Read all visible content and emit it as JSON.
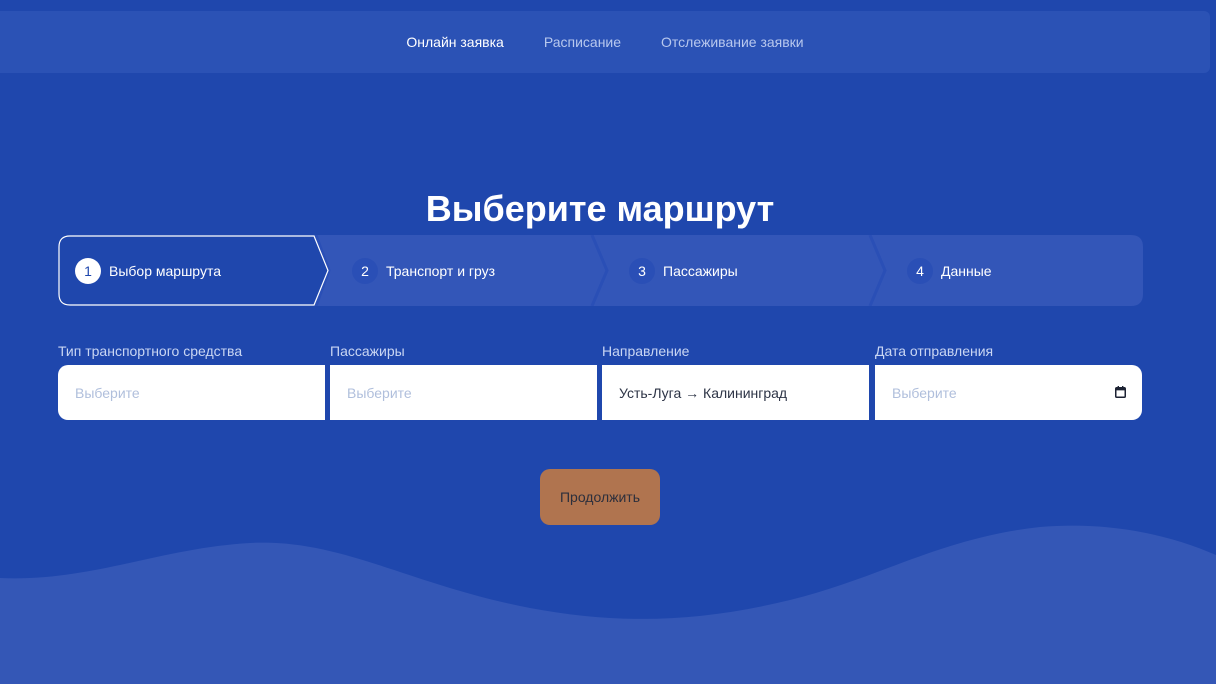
{
  "nav": {
    "items": [
      {
        "label": "Онлайн заявка",
        "active": true
      },
      {
        "label": "Расписание",
        "active": false
      },
      {
        "label": "Отслеживание заявки",
        "active": false
      }
    ]
  },
  "title": "Выберите маршрут",
  "steps": [
    {
      "number": "1",
      "label": "Выбор маршрута",
      "active": true
    },
    {
      "number": "2",
      "label": "Транспорт и груз",
      "active": false
    },
    {
      "number": "3",
      "label": "Пассажиры",
      "active": false
    },
    {
      "number": "4",
      "label": "Данные",
      "active": false
    }
  ],
  "form": {
    "vehicle_type": {
      "label": "Тип транспортного средства",
      "placeholder": "Выберите",
      "value": ""
    },
    "passengers": {
      "label": "Пассажиры",
      "placeholder": "Выберите",
      "value": ""
    },
    "direction": {
      "label": "Направление",
      "value": "Усть-Луга → Калининград"
    },
    "departure_date": {
      "label": "Дата отправления",
      "placeholder": "Выберите",
      "value": ""
    }
  },
  "continue_label": "Продолжить",
  "icons": {
    "calendar": "calendar-icon"
  },
  "colors": {
    "background": "#1f47ad",
    "navbar": "#2b52b5",
    "wave": "#3457b6",
    "stepper_bg": "#3356b8",
    "accent_button": "#b0744f",
    "field_bg": "#ffffff"
  }
}
